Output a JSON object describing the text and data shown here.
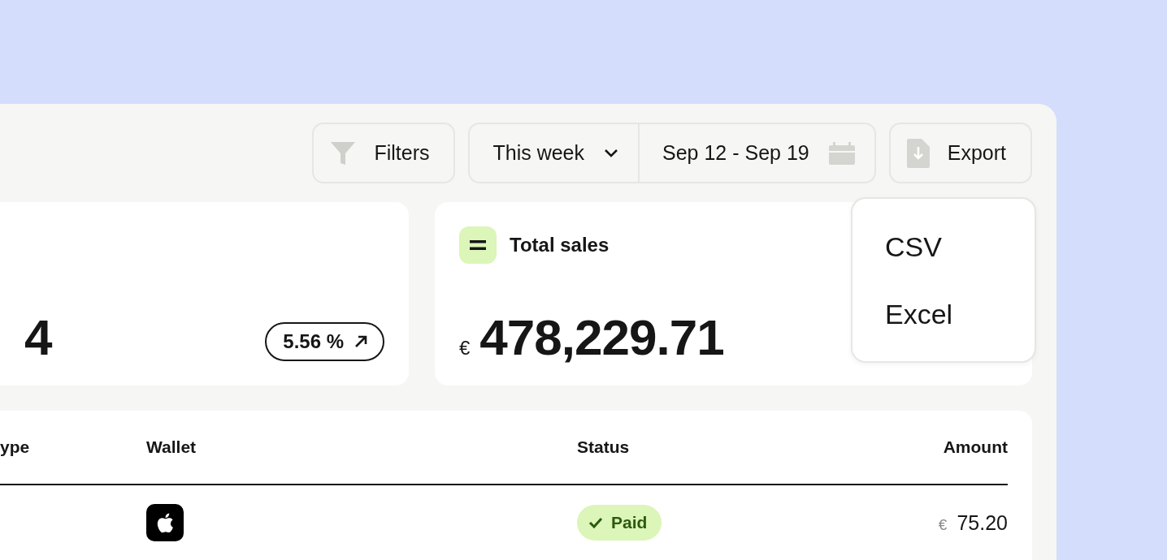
{
  "toolbar": {
    "filters": {
      "label": "Filters"
    },
    "period": {
      "value": "This week"
    },
    "date_range": {
      "value": "Sep 12 - Sep 19"
    },
    "export": {
      "label": "Export"
    }
  },
  "export_menu": {
    "items": [
      "CSV",
      "Excel"
    ]
  },
  "cards": [
    {
      "kind": "change",
      "value": "4",
      "change": "5.56 %"
    },
    {
      "kind": "total",
      "title": "Total sales",
      "currency": "€",
      "value": "478,229.71"
    }
  ],
  "table": {
    "columns": [
      "ype",
      "Wallet",
      "Status",
      "Amount"
    ],
    "rows": [
      {
        "status": {
          "kind": "paid",
          "label": "Paid"
        },
        "currency": "€",
        "amount": "75.20"
      }
    ]
  }
}
